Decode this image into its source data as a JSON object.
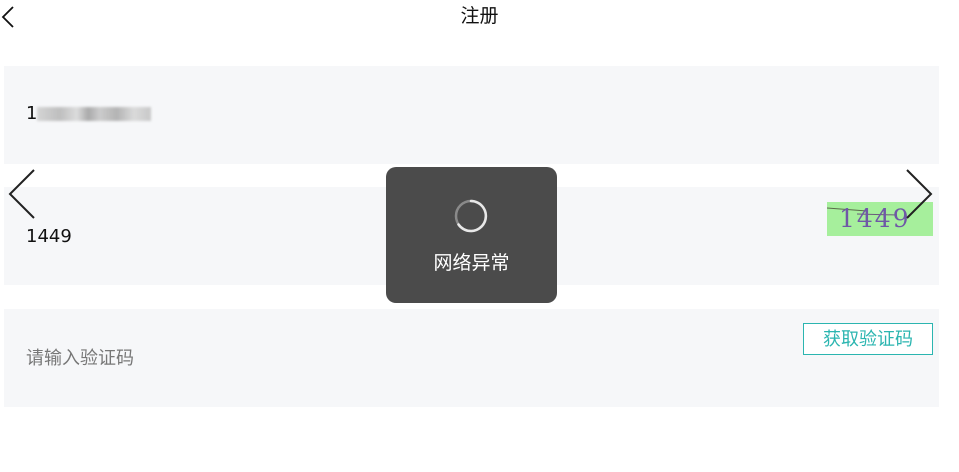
{
  "header": {
    "title": "注册",
    "back_icon": "chevron-left-icon"
  },
  "form": {
    "phone": {
      "value_prefix": "1",
      "value_note": "remaining digits blurred"
    },
    "captcha": {
      "value": "1449",
      "image_text": "1449",
      "image_bg": "#a6ef9c"
    },
    "sms_code": {
      "placeholder": "请输入验证码",
      "button_label": "获取验证码"
    }
  },
  "carousel": {
    "prev_icon": "chevron-left-icon",
    "next_icon": "chevron-right-icon"
  },
  "toast": {
    "message": "网络异常",
    "icon": "spinner-icon"
  },
  "colors": {
    "accent": "#2bb5b0",
    "row_bg": "#f6f7f9",
    "toast_bg": "#4b4b4b"
  }
}
